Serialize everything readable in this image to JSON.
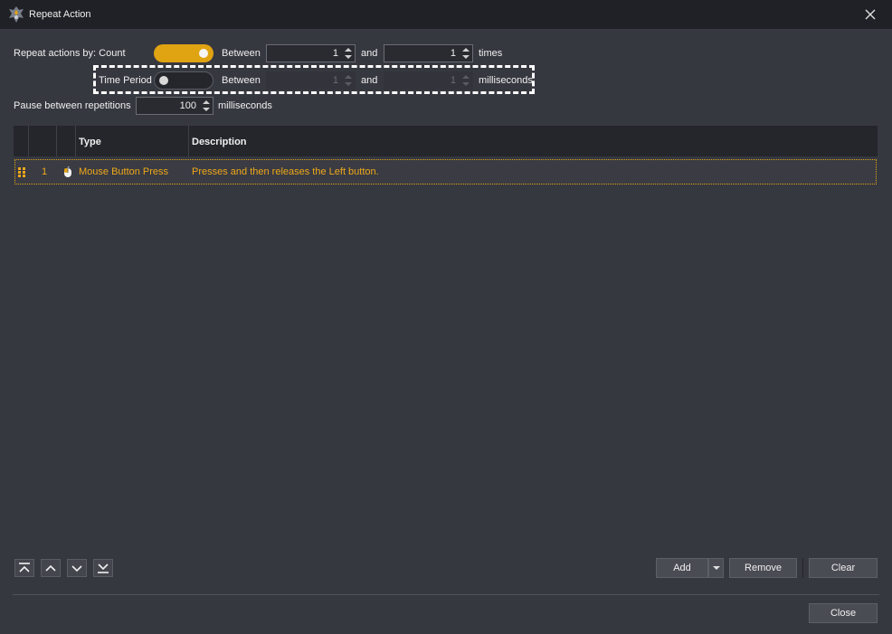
{
  "window": {
    "title": "Repeat Action"
  },
  "repeat": {
    "by_label": "Repeat actions by: Count",
    "count_toggle_on": true,
    "between_label": "Between",
    "min": "1",
    "and_label": "and",
    "max": "1",
    "times_label": "times"
  },
  "time_period": {
    "label": "Time Period",
    "toggle_on": false,
    "between_label": "Between",
    "min": "1",
    "and_label": "and",
    "max": "1",
    "unit_label": "milliseconds"
  },
  "pause": {
    "label": "Pause between repetitions",
    "value": "100",
    "unit_label": "milliseconds"
  },
  "table": {
    "columns": [
      "",
      "",
      "",
      "Type",
      "Description"
    ],
    "rows": [
      {
        "index": "1",
        "icon": "mouse-icon",
        "type": "Mouse Button Press",
        "description": "Presses and then releases the Left button."
      }
    ]
  },
  "buttons": {
    "add": "Add",
    "remove": "Remove",
    "clear": "Clear",
    "close": "Close"
  },
  "colors": {
    "accent": "#e0a312",
    "background": "#363840",
    "titlebar": "#202126"
  }
}
